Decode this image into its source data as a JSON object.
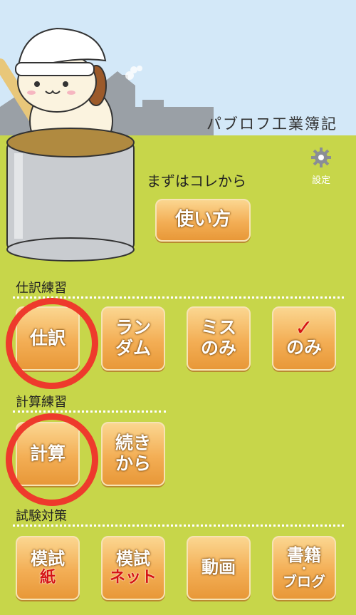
{
  "header": {
    "app_title": "パブロフ工業簿記"
  },
  "settings": {
    "label": "設定",
    "icon": "gear-icon"
  },
  "intro": {
    "label": "まずはコレから",
    "howto_button": "使い方"
  },
  "sections": {
    "journal": {
      "label": "仕訳練習",
      "buttons": {
        "journal": "仕訳",
        "random_1": "ラン",
        "random_2": "ダム",
        "mistakes_1": "ミス",
        "mistakes_2": "のみ",
        "check_mark": "✓",
        "checked_only": "のみ"
      }
    },
    "calc": {
      "label": "計算練習",
      "buttons": {
        "calc": "計算",
        "continue_1": "続き",
        "continue_2": "から"
      }
    },
    "exam": {
      "label": "試験対策",
      "buttons": {
        "mock_paper_1": "模試",
        "mock_paper_2": "紙",
        "mock_net_1": "模試",
        "mock_net_2": "ネット",
        "video": "動画",
        "books_1": "書籍",
        "books_dot": "・",
        "books_2": "ブログ"
      }
    }
  },
  "colors": {
    "sky": "#d3e8f8",
    "ground": "#c7d64a",
    "button": "#f3ae55",
    "highlight_circle": "#ee3a2c",
    "accent_red": "#d51414"
  }
}
